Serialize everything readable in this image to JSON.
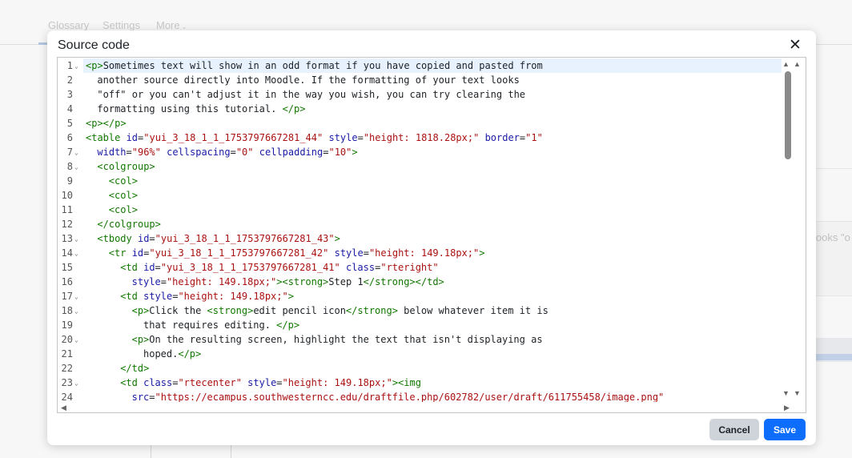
{
  "background": {
    "nav_tabs": [
      "Glossary",
      "Settings",
      "More"
    ],
    "more_chevron": "chevron-down-icon",
    "side_text": "looks \"o"
  },
  "modal": {
    "title": "Source code",
    "close_icon": "close-icon",
    "close_glyph": "✕",
    "cancel_label": "Cancel",
    "save_label": "Save"
  },
  "colors": {
    "tag": "#117700",
    "attribute": "#1a1aa6",
    "string": "#aa1111",
    "save_button": "#0d6efd",
    "active_line": "#e8f2ff"
  },
  "editor": {
    "lines": [
      {
        "n": "1",
        "fold": true,
        "indent": 0,
        "seg": [
          [
            "t",
            "<p>"
          ],
          [
            "x",
            "Sometimes text will show in an odd format if you have copied and pasted from"
          ]
        ]
      },
      {
        "n": "2",
        "fold": false,
        "indent": 1,
        "seg": [
          [
            "x",
            "another source directly into Moodle. If the formatting of your text looks"
          ]
        ]
      },
      {
        "n": "3",
        "fold": false,
        "indent": 1,
        "seg": [
          [
            "x",
            "\"off\" or you can't adjust it in the way you wish, you can try clearing the"
          ]
        ]
      },
      {
        "n": "4",
        "fold": false,
        "indent": 1,
        "seg": [
          [
            "x",
            "formatting using this tutorial. "
          ],
          [
            "t",
            "</p>"
          ]
        ]
      },
      {
        "n": "5",
        "fold": false,
        "indent": 0,
        "seg": [
          [
            "t",
            "<p></p>"
          ]
        ]
      },
      {
        "n": "6",
        "fold": false,
        "indent": 0,
        "seg": [
          [
            "t",
            "<table "
          ],
          [
            "a",
            "id"
          ],
          [
            "x",
            "="
          ],
          [
            "s",
            "\"yui_3_18_1_1_1753797667281_44\""
          ],
          [
            "x",
            " "
          ],
          [
            "a",
            "style"
          ],
          [
            "x",
            "="
          ],
          [
            "s",
            "\"height: 1818.28px;\""
          ],
          [
            "x",
            " "
          ],
          [
            "a",
            "border"
          ],
          [
            "x",
            "="
          ],
          [
            "s",
            "\"1\""
          ]
        ]
      },
      {
        "n": "7",
        "fold": true,
        "indent": 1,
        "seg": [
          [
            "a",
            "width"
          ],
          [
            "x",
            "="
          ],
          [
            "s",
            "\"96%\""
          ],
          [
            "x",
            " "
          ],
          [
            "a",
            "cellspacing"
          ],
          [
            "x",
            "="
          ],
          [
            "s",
            "\"0\""
          ],
          [
            "x",
            " "
          ],
          [
            "a",
            "cellpadding"
          ],
          [
            "x",
            "="
          ],
          [
            "s",
            "\"10\""
          ],
          [
            "t",
            ">"
          ]
        ]
      },
      {
        "n": "8",
        "fold": true,
        "indent": 1,
        "seg": [
          [
            "t",
            "<colgroup>"
          ]
        ]
      },
      {
        "n": "9",
        "fold": false,
        "indent": 2,
        "seg": [
          [
            "t",
            "<col>"
          ]
        ]
      },
      {
        "n": "10",
        "fold": false,
        "indent": 2,
        "seg": [
          [
            "t",
            "<col>"
          ]
        ]
      },
      {
        "n": "11",
        "fold": false,
        "indent": 2,
        "seg": [
          [
            "t",
            "<col>"
          ]
        ]
      },
      {
        "n": "12",
        "fold": false,
        "indent": 1,
        "seg": [
          [
            "t",
            "</colgroup>"
          ]
        ]
      },
      {
        "n": "13",
        "fold": true,
        "indent": 1,
        "seg": [
          [
            "t",
            "<tbody "
          ],
          [
            "a",
            "id"
          ],
          [
            "x",
            "="
          ],
          [
            "s",
            "\"yui_3_18_1_1_1753797667281_43\""
          ],
          [
            "t",
            ">"
          ]
        ]
      },
      {
        "n": "14",
        "fold": true,
        "indent": 2,
        "seg": [
          [
            "t",
            "<tr "
          ],
          [
            "a",
            "id"
          ],
          [
            "x",
            "="
          ],
          [
            "s",
            "\"yui_3_18_1_1_1753797667281_42\""
          ],
          [
            "x",
            " "
          ],
          [
            "a",
            "style"
          ],
          [
            "x",
            "="
          ],
          [
            "s",
            "\"height: 149.18px;\""
          ],
          [
            "t",
            ">"
          ]
        ]
      },
      {
        "n": "15",
        "fold": false,
        "indent": 3,
        "seg": [
          [
            "t",
            "<td "
          ],
          [
            "a",
            "id"
          ],
          [
            "x",
            "="
          ],
          [
            "s",
            "\"yui_3_18_1_1_1753797667281_41\""
          ],
          [
            "x",
            " "
          ],
          [
            "a",
            "class"
          ],
          [
            "x",
            "="
          ],
          [
            "s",
            "\"rteright\""
          ]
        ]
      },
      {
        "n": "16",
        "fold": false,
        "indent": 4,
        "seg": [
          [
            "a",
            "style"
          ],
          [
            "x",
            "="
          ],
          [
            "s",
            "\"height: 149.18px;\""
          ],
          [
            "t",
            ">"
          ],
          [
            "t",
            "<strong>"
          ],
          [
            "x",
            "Step 1"
          ],
          [
            "t",
            "</strong>"
          ],
          [
            "t",
            "</td>"
          ]
        ]
      },
      {
        "n": "17",
        "fold": true,
        "indent": 3,
        "seg": [
          [
            "t",
            "<td "
          ],
          [
            "a",
            "style"
          ],
          [
            "x",
            "="
          ],
          [
            "s",
            "\"height: 149.18px;\""
          ],
          [
            "t",
            ">"
          ]
        ]
      },
      {
        "n": "18",
        "fold": true,
        "indent": 4,
        "seg": [
          [
            "t",
            "<p>"
          ],
          [
            "x",
            "Click the "
          ],
          [
            "t",
            "<strong>"
          ],
          [
            "x",
            "edit pencil icon"
          ],
          [
            "t",
            "</strong>"
          ],
          [
            "x",
            " below whatever item it is"
          ]
        ]
      },
      {
        "n": "19",
        "fold": false,
        "indent": 5,
        "seg": [
          [
            "x",
            "that requires editing. "
          ],
          [
            "t",
            "</p>"
          ]
        ]
      },
      {
        "n": "20",
        "fold": true,
        "indent": 4,
        "seg": [
          [
            "t",
            "<p>"
          ],
          [
            "x",
            "On the resulting screen, highlight the text that isn't displaying as"
          ]
        ]
      },
      {
        "n": "21",
        "fold": false,
        "indent": 5,
        "seg": [
          [
            "x",
            "hoped."
          ],
          [
            "t",
            "</p>"
          ]
        ]
      },
      {
        "n": "22",
        "fold": false,
        "indent": 3,
        "seg": [
          [
            "t",
            "</td>"
          ]
        ]
      },
      {
        "n": "23",
        "fold": true,
        "indent": 3,
        "seg": [
          [
            "t",
            "<td "
          ],
          [
            "a",
            "class"
          ],
          [
            "x",
            "="
          ],
          [
            "s",
            "\"rtecenter\""
          ],
          [
            "x",
            " "
          ],
          [
            "a",
            "style"
          ],
          [
            "x",
            "="
          ],
          [
            "s",
            "\"height: 149.18px;\""
          ],
          [
            "t",
            ">"
          ],
          [
            "t",
            "<img"
          ]
        ]
      },
      {
        "n": "24",
        "fold": false,
        "indent": 4,
        "seg": [
          [
            "a",
            "src"
          ],
          [
            "x",
            "="
          ],
          [
            "s",
            "\"https://ecampus.southwesterncc.edu/draftfile.php/602782/user/draft/611755458/image.png\""
          ]
        ]
      }
    ]
  }
}
